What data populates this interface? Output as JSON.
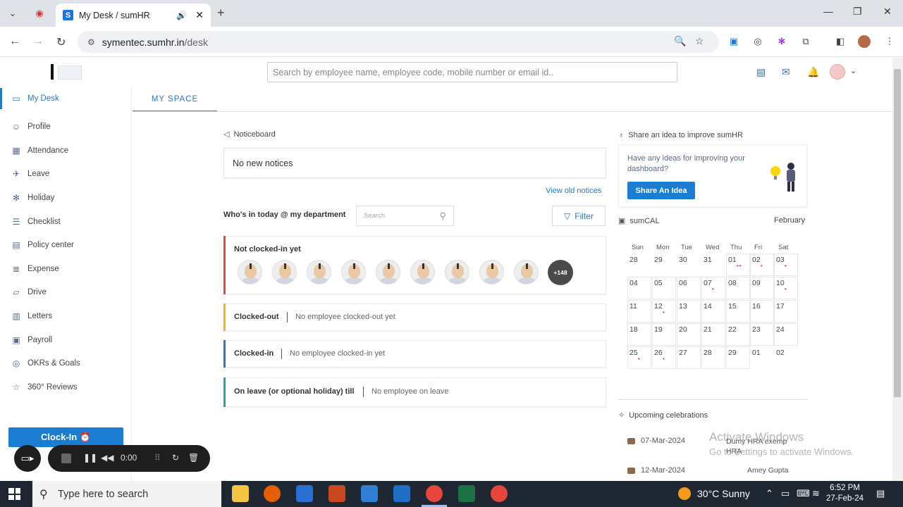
{
  "browser": {
    "tab_title": "My Desk / sumHR",
    "tab_favicon": "S",
    "url_host": "symentec.sumhr.in",
    "url_path": "/desk"
  },
  "header": {
    "search_placeholder": "Search by employee name, employee code, mobile number or email id.."
  },
  "sidebar": {
    "items": [
      {
        "label": "My Desk",
        "icon": "monitor-icon",
        "active": true
      },
      {
        "label": "Profile",
        "icon": "person-icon"
      },
      {
        "label": "Attendance",
        "icon": "calendar-icon"
      },
      {
        "label": "Leave",
        "icon": "plane-icon"
      },
      {
        "label": "Holiday",
        "icon": "holiday-icon"
      },
      {
        "label": "Checklist",
        "icon": "checklist-icon"
      },
      {
        "label": "Policy center",
        "icon": "policy-icon"
      },
      {
        "label": "Expense",
        "icon": "expense-icon"
      },
      {
        "label": "Drive",
        "icon": "folder-icon"
      },
      {
        "label": "Letters",
        "icon": "letters-icon"
      },
      {
        "label": "Payroll",
        "icon": "payroll-icon"
      },
      {
        "label": "OKRs & Goals",
        "icon": "goals-icon"
      },
      {
        "label": "360° Reviews",
        "icon": "star-icon"
      }
    ],
    "clock_in_label": "Clock-In ⏰"
  },
  "recorder": {
    "time": "0:00"
  },
  "main": {
    "tab_label": "MY SPACE",
    "noticeboard": {
      "title": "Noticeboard",
      "message": "No new notices",
      "view_old": "View old notices"
    },
    "whos_in": {
      "title": "Who's in today @ my department",
      "search_placeholder": "Search",
      "filter_label": "Filter"
    },
    "not_clocked_in": {
      "title": "Not clocked-in yet",
      "more_count": "+148"
    },
    "clocked_out": {
      "title": "Clocked-out",
      "message": "No employee clocked-out yet"
    },
    "clocked_in": {
      "title": "Clocked-in",
      "message": "No employee clocked-in yet"
    },
    "on_leave": {
      "title": "On leave (or optional holiday) till",
      "message": "No employee on leave"
    }
  },
  "right": {
    "idea": {
      "title": "Share an idea to improve sumHR",
      "text": "Have any ideas for improving your dashboard?",
      "button": "Share An Idea"
    },
    "calendar": {
      "title": "sumCAL",
      "month": "February",
      "weekdays": [
        "Sun",
        "Mon",
        "Tue",
        "Wed",
        "Thu",
        "Fri",
        "Sat"
      ],
      "weeks": [
        [
          {
            "d": "28"
          },
          {
            "d": "29"
          },
          {
            "d": "30"
          },
          {
            "d": "31"
          },
          {
            "d": "01",
            "dots": "••",
            "cell": true
          },
          {
            "d": "02",
            "dots": "•",
            "cell": true
          },
          {
            "d": "03",
            "dots": "•",
            "cell": true
          }
        ],
        [
          {
            "d": "04",
            "cell": true
          },
          {
            "d": "05",
            "cell": true
          },
          {
            "d": "06",
            "cell": true
          },
          {
            "d": "07",
            "dots": "•",
            "cell": true
          },
          {
            "d": "08",
            "cell": true
          },
          {
            "d": "09",
            "cell": true
          },
          {
            "d": "10",
            "dots": "•",
            "cell": true
          }
        ],
        [
          {
            "d": "11",
            "cell": true
          },
          {
            "d": "12",
            "dots": "•",
            "cell": true
          },
          {
            "d": "13",
            "cell": true
          },
          {
            "d": "14",
            "cell": true
          },
          {
            "d": "15",
            "cell": true
          },
          {
            "d": "16",
            "cell": true
          },
          {
            "d": "17",
            "cell": true
          }
        ],
        [
          {
            "d": "18",
            "cell": true
          },
          {
            "d": "19",
            "cell": true
          },
          {
            "d": "20",
            "cell": true
          },
          {
            "d": "21",
            "cell": true
          },
          {
            "d": "22",
            "cell": true
          },
          {
            "d": "23",
            "cell": true
          },
          {
            "d": "24",
            "cell": true
          }
        ],
        [
          {
            "d": "25",
            "dots": "•",
            "cell": true
          },
          {
            "d": "26",
            "dots": "•",
            "cell": true
          },
          {
            "d": "27",
            "cell": true
          },
          {
            "d": "28",
            "cell": true
          },
          {
            "d": "29",
            "cell": true
          },
          {
            "d": "01"
          },
          {
            "d": "02"
          }
        ]
      ]
    },
    "celebrations": {
      "title": "Upcoming celebrations",
      "items": [
        {
          "date": "07-Mar-2024",
          "name": "Dumy HRA exemp HRA"
        },
        {
          "date": "12-Mar-2024",
          "name": "Amey Gupta"
        }
      ]
    }
  },
  "watermark": {
    "line1": "Activate Windows",
    "line2": "Go to Settings to activate Windows."
  },
  "taskbar": {
    "search_placeholder": "Type here to search",
    "weather": "30°C  Sunny",
    "time": "6:52 PM",
    "date": "27-Feb-24"
  }
}
